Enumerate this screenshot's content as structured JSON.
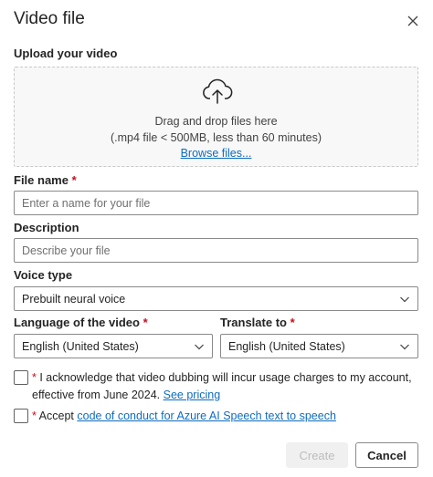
{
  "dialog": {
    "title": "Video file",
    "close_icon": "close-icon"
  },
  "upload": {
    "label": "Upload your video",
    "icon": "cloud-upload-icon",
    "drag_text": "Drag and drop files here",
    "limits_text": "(.mp4 file < 500MB, less than 60 minutes)",
    "browse_label": "Browse files..."
  },
  "file_name": {
    "label": "File name",
    "required_mark": "*",
    "placeholder": "Enter a name for your file",
    "value": ""
  },
  "description": {
    "label": "Description",
    "placeholder": "Describe your file",
    "value": ""
  },
  "voice_type": {
    "label": "Voice type",
    "value": "Prebuilt neural voice"
  },
  "video_language": {
    "label": "Language of the video",
    "required_mark": "*",
    "value": "English (United States)"
  },
  "translate_to": {
    "label": "Translate to",
    "required_mark": "*",
    "value": "English (United States)"
  },
  "acknowledge": {
    "required_mark": "*",
    "text_line1": "I acknowledge that video dubbing will incur usage charges to my account,",
    "text_line2": "effective from June 2024.",
    "link_label": "See pricing",
    "checked": false
  },
  "accept": {
    "required_mark": "*",
    "text": "Accept",
    "link_label": "code of conduct for Azure AI Speech text to speech",
    "checked": false
  },
  "footer": {
    "create_label": "Create",
    "cancel_label": "Cancel"
  },
  "colors": {
    "accent": "#0f6cbd",
    "required": "#c50f1f",
    "disabled_text": "#bdbdbd"
  }
}
